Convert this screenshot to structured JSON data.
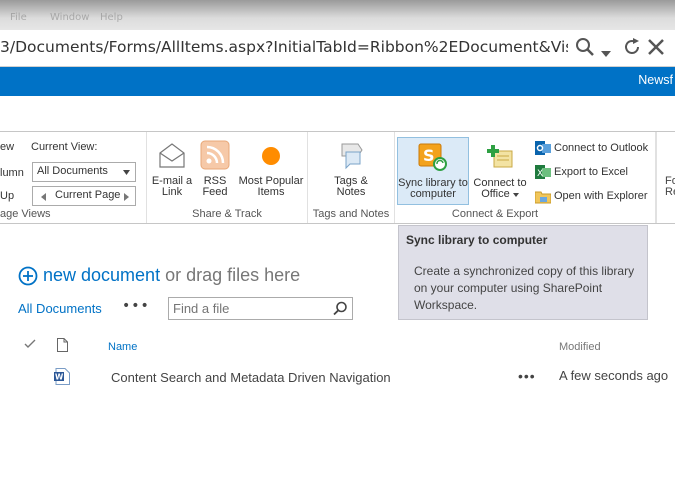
{
  "browser": {
    "menu_items": [
      "File",
      "Window",
      "Help"
    ],
    "url": "3/Documents/Forms/AllItems.aspx?InitialTabId=Ribbon%2EDocument&VisibilityConte"
  },
  "suite_bar": {
    "newsfeed": "Newsf"
  },
  "ribbon": {
    "view_group": {
      "view_label": "ew",
      "current_view_label": "Current View:",
      "column_label": "lumn",
      "current_view_value": "All Documents",
      "up_label": "Up",
      "current_page": "Current Page",
      "group_label": "age Views"
    },
    "share_group": {
      "email_link": [
        "E-mail a",
        "Link"
      ],
      "rss_feed": [
        "RSS",
        "Feed"
      ],
      "most_popular": [
        "Most Popular",
        "Items"
      ],
      "group_label": "Share & Track"
    },
    "tags_group": {
      "tags_notes": [
        "Tags &",
        "Notes"
      ],
      "group_label": "Tags and Notes"
    },
    "connect_group": {
      "sync_library": [
        "Sync library to",
        "computer"
      ],
      "connect_office": [
        "Connect to",
        "Office"
      ],
      "connect_outlook": "Connect to Outlook",
      "export_excel": "Export to Excel",
      "open_explorer": "Open with Explorer",
      "group_label": "Connect & Export"
    },
    "cut_group": {
      "label": [
        "Fo",
        "Re"
      ]
    }
  },
  "tooltip": {
    "title": "Sync library to computer",
    "body": "Create a synchronized copy of this library on your computer using SharePoint Workspace."
  },
  "library": {
    "new_document": "new document",
    "drag_text": "or drag files here",
    "view_name": "All Documents",
    "more": "•••",
    "search_placeholder": "Find a file",
    "columns": {
      "name": "Name",
      "modified": "Modified"
    },
    "rows": [
      {
        "name": "Content Search and Metadata Driven Navigation",
        "modified": "A few seconds ago"
      }
    ]
  },
  "colors": {
    "accent": "#0072c6",
    "suite_bar": "#0072c6"
  }
}
